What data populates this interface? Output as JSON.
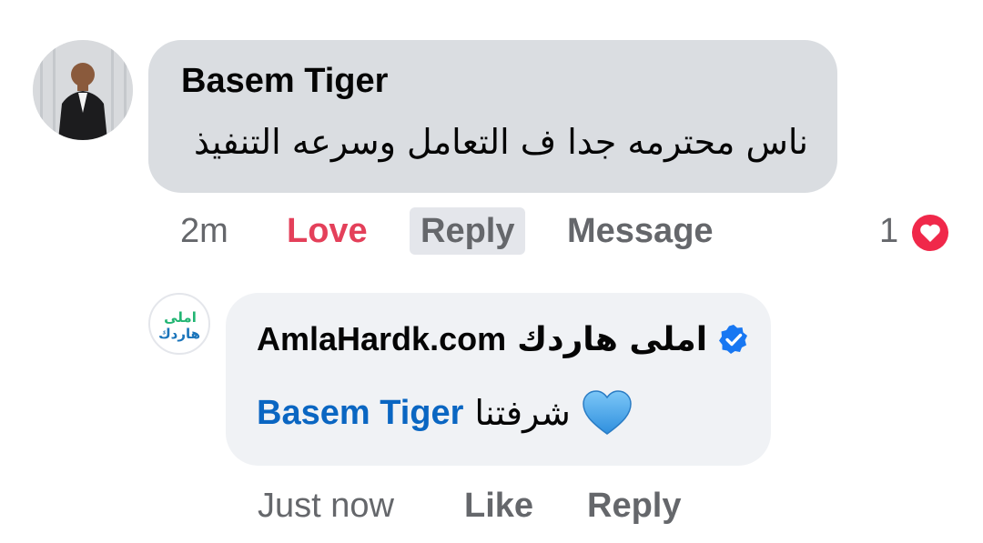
{
  "comment": {
    "author": "Basem Tiger",
    "text": "ناس محترمه جدا ف التعامل وسرعه التنفيذ",
    "time": "2m",
    "love_label": "Love",
    "reply_label": "Reply",
    "message_label": "Message",
    "reaction_count": "1"
  },
  "reply": {
    "author_domain": "AmlaHardk.com",
    "author_arabic": "املى هاردك",
    "mention": "Basem Tiger",
    "text": "شرفتنا",
    "time": "Just now",
    "like_label": "Like",
    "reply_label": "Reply",
    "logo_line1": "املى",
    "logo_line2": "هاردك"
  },
  "colors": {
    "love": "#e4405a",
    "mention": "#0a66c2",
    "verified": "#1877f2"
  }
}
